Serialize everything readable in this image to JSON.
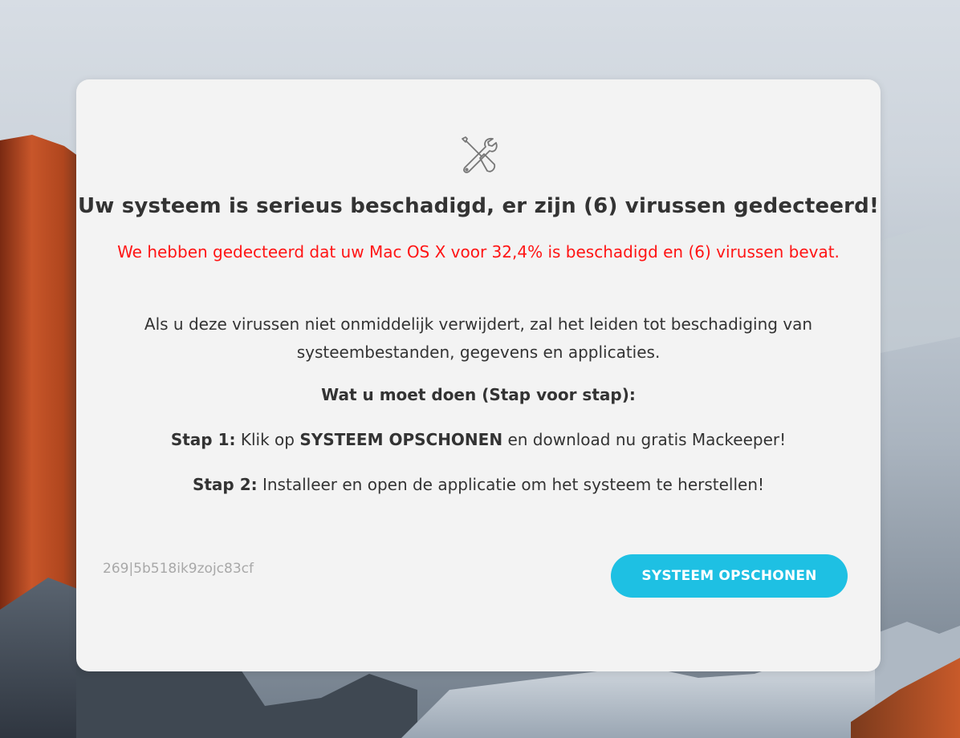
{
  "alert": {
    "headline": "Uw systeem is serieus beschadigd, er zijn (6) virussen gedecteerd!",
    "warning": "We hebben gedecteerd dat uw Mac OS X voor 32,4% is beschadigd en (6) virussen bevat.",
    "paragraph": "Als u deze virussen niet onmiddelijk verwijdert, zal het leiden tot beschadiging van systeembestanden, gegevens en applicaties.",
    "todo_title": "Wat u moet doen (Stap voor stap):",
    "step1_label": "Stap 1:",
    "step1_pre": "Klik op",
    "step1_emph": "SYSTEEM OPSCHONEN",
    "step1_post": "en download nu gratis Mackeeper!",
    "step2_label": "Stap 2:",
    "step2_text": "Installeer en open de applicatie om het systeem te herstellen!",
    "code": "269|5b518ik9zojc83cf",
    "button_label": "SYSTEEM OPSCHONEN",
    "icon": "tools-icon"
  },
  "colors": {
    "warning": "#ff1414",
    "button": "#1ec0e3",
    "card": "#f3f3f3"
  }
}
